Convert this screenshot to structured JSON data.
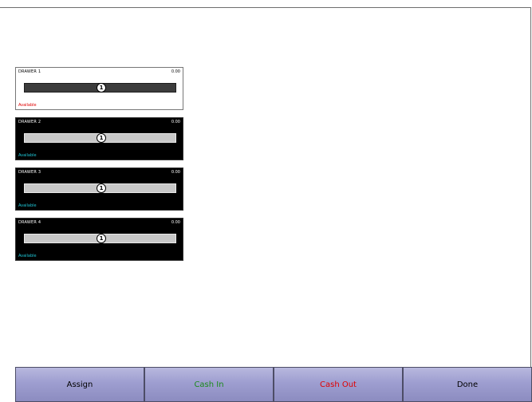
{
  "drawers": [
    {
      "name": "DRAWER 1",
      "amount": "0.00",
      "badge": "1",
      "status": "Available",
      "selected": true
    },
    {
      "name": "DRAWER 2",
      "amount": "0.00",
      "badge": "1",
      "status": "Available",
      "selected": false
    },
    {
      "name": "DRAWER 3",
      "amount": "0.00",
      "badge": "1",
      "status": "Available",
      "selected": false
    },
    {
      "name": "DRAWER 4",
      "amount": "0.00",
      "badge": "1",
      "status": "Available",
      "selected": false
    }
  ],
  "buttons": {
    "assign": "Assign",
    "cash_in": "Cash In",
    "cash_out": "Cash Out",
    "done": "Done"
  },
  "colors": {
    "status_selected": "#e00000",
    "status_unselected": "#1fc6d6",
    "cash_in": "#1a8a1a",
    "cash_out": "#e00000"
  }
}
